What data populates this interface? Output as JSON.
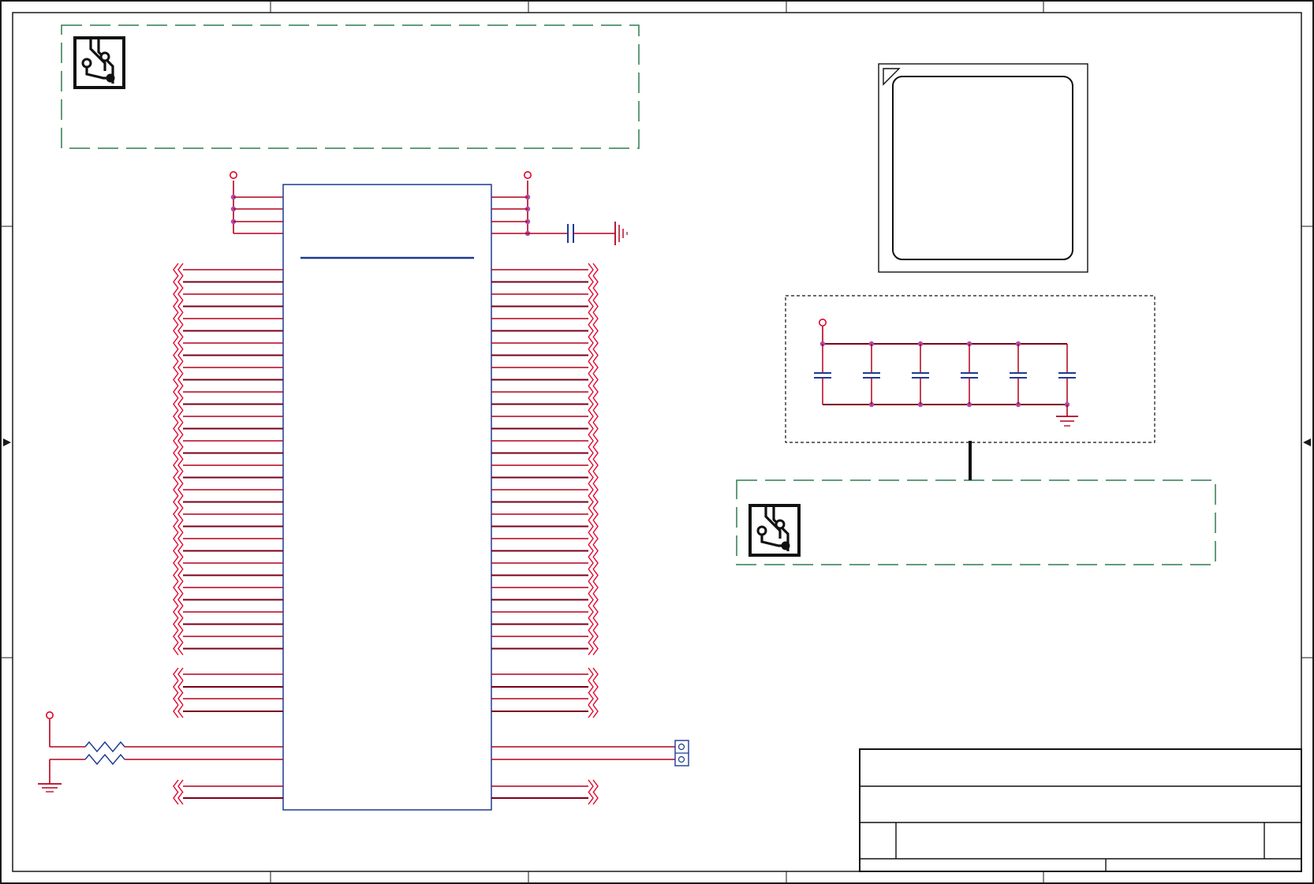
{
  "schematic": {
    "colors": {
      "frame": "#1a1a1a",
      "wire": "#b3001b",
      "pin": "#e4002b",
      "component_body": "#1f3a93",
      "junction": "#b04ca8",
      "note_border": "#2e7d4f",
      "ground": "#b3001b"
    },
    "icons": [
      "pcb-trace-logo-icon",
      "ground-symbol-icon",
      "power-port-icon",
      "capacitor-symbol-icon",
      "resistor-symbol-icon",
      "header-connector-icon",
      "net-port-arrow-icon"
    ],
    "ic": {
      "left_bus_pins": 32,
      "right_bus_pins": 32,
      "left_aux_pins": 4,
      "right_aux_pins": 4
    },
    "decoupling": {
      "capacitor_count": 6
    },
    "title_block": {
      "rows": 3
    }
  }
}
